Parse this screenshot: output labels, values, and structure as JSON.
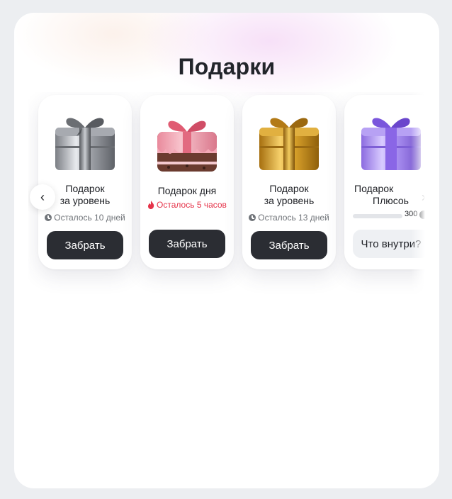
{
  "title": "Подарки",
  "nav": {
    "prev_symbol": "‹",
    "next_symbol": "›"
  },
  "cards": [
    {
      "title_line1": "Подарок",
      "title_line2": "за уровень",
      "timer": "Осталось 10 дней",
      "button": "Забрать",
      "gift": "silver-gift-icon"
    },
    {
      "title_line1": "Подарок дня",
      "title_line2": "",
      "timer": "Осталось 5 часов",
      "button": "Забрать",
      "gift": "cake-gift-icon"
    },
    {
      "title_line1": "Подарок",
      "title_line2": "за уровень",
      "timer": "Осталось 13 дней",
      "button": "Забрать",
      "gift": "gold-gift-icon"
    },
    {
      "title_line1": "Подарок",
      "title_line2": "Плюсоь",
      "progress_value": "300",
      "progress_fraction": 0.0,
      "button": "Что внутри?",
      "gift": "purple-gift-icon"
    }
  ],
  "colors": {
    "accent_dark": "#2b2d33",
    "urgent": "#e5344a",
    "silver": "#b8bbc2",
    "gold": "#d9a62a",
    "purple": "#a98cf0",
    "cake": "#f0a0b0"
  }
}
